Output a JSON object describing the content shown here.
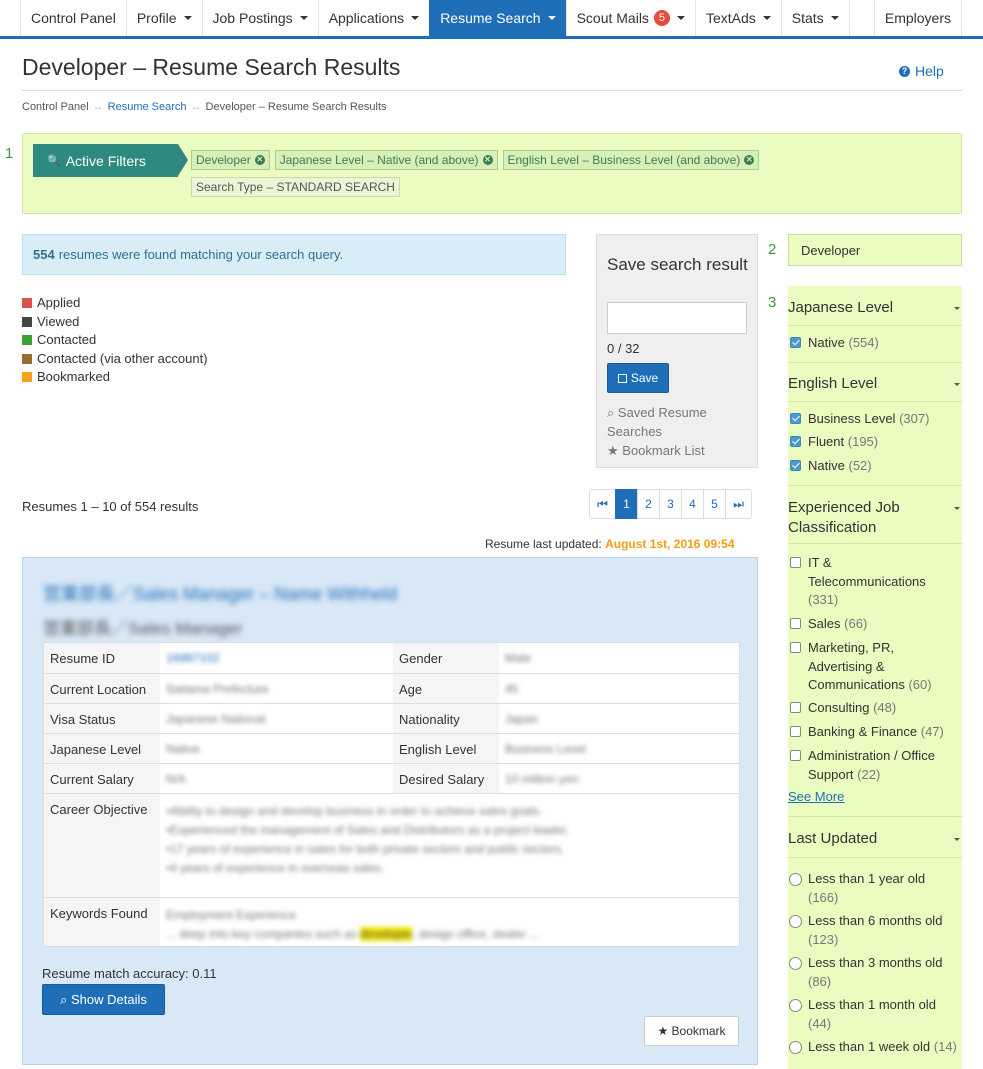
{
  "nav": {
    "items": [
      {
        "label": "Control Panel",
        "caret": false
      },
      {
        "label": "Profile",
        "caret": true
      },
      {
        "label": "Job Postings",
        "caret": true
      },
      {
        "label": "Applications",
        "caret": true
      },
      {
        "label": "Resume Search",
        "caret": true,
        "active": true
      },
      {
        "label": "Scout Mails",
        "caret": true,
        "badge": "5"
      },
      {
        "label": "TextAds",
        "caret": true
      },
      {
        "label": "Stats",
        "caret": true
      }
    ],
    "employers": "Employers"
  },
  "page": {
    "title": "Developer – Resume Search Results",
    "help": "Help",
    "breadcrumb": [
      "Control Panel",
      "Resume Search",
      "Developer – Resume Search Results"
    ]
  },
  "steps": [
    "1",
    "2",
    "3"
  ],
  "filters": {
    "label": "Active Filters",
    "chips": [
      {
        "text": "Developer",
        "removable": true
      },
      {
        "text": "Japanese Level – Native (and above)",
        "removable": true
      },
      {
        "text": "English Level – Business Level (and above)",
        "removable": true
      },
      {
        "text": "Search Type – STANDARD SEARCH",
        "removable": false
      }
    ]
  },
  "results": {
    "count": "554",
    "message": "resumes were found matching your search query.",
    "range": "Resumes 1 – 10 of 554 results",
    "updated_label": "Resume last updated:",
    "updated_value": "August 1st, 2016 09:54"
  },
  "legend": [
    {
      "label": "Applied",
      "color": "#d9534f"
    },
    {
      "label": "Viewed",
      "color": "#444444"
    },
    {
      "label": "Contacted",
      "color": "#3aa335"
    },
    {
      "label": "Contacted (via other account)",
      "color": "#9c6a35"
    },
    {
      "label": "Bookmarked",
      "color": "#f7a21b"
    }
  ],
  "save_search": {
    "title": "Save search result",
    "value": "",
    "count": "0 / 32",
    "button": "Save",
    "saved_link": "Saved Resume Searches",
    "bookmark_link": "Bookmark List"
  },
  "pagination": {
    "first": "⏮",
    "pages": [
      "1",
      "2",
      "3",
      "4",
      "5"
    ],
    "current": "1",
    "last": "⏭"
  },
  "resume": {
    "title": "営業部長／Sales Manager – Name Withheld",
    "subtitle": "営業部長／Sales Manager",
    "fields": {
      "resume_id_label": "Resume ID",
      "resume_id": "16987102",
      "gender_label": "Gender",
      "gender": "Male",
      "location_label": "Current Location",
      "location": "Saitama Prefecture",
      "age_label": "Age",
      "age": "45",
      "visa_label": "Visa Status",
      "visa": "Japanese National",
      "nationality_label": "Nationality",
      "nationality": "Japan",
      "jp_level_label": "Japanese Level",
      "jp_level": "Native",
      "en_level_label": "English Level",
      "en_level": "Business Level",
      "current_salary_label": "Current Salary",
      "current_salary": "N/A",
      "desired_salary_label": "Desired Salary",
      "desired_salary": "10 million yen",
      "objective_label": "Career Objective",
      "objective_lines": [
        "•Ability to design and develop business in order to achieve sales goals.",
        "•Experienced the management of Sales and Distributors as a project leader.",
        "•17 years of experience in sales for both private sectors and public sectors.",
        "•4 years of experience in overseas sales."
      ],
      "keywords_label": "Keywords Found",
      "keywords_heading": "Employment Experience",
      "keywords_pre": "... deep into key companies such as ",
      "keywords_hl": "developer",
      "keywords_post": ", design office, dealer ..."
    },
    "accuracy": "Resume match accuracy: 0.11",
    "show_details": "Show Details",
    "bookmark": "Bookmark"
  },
  "sidebar": {
    "keyword": "Developer",
    "japanese": {
      "title": "Japanese Level",
      "options": [
        {
          "label": "Native",
          "count": "(554)",
          "checked": true
        }
      ]
    },
    "english": {
      "title": "English Level",
      "options": [
        {
          "label": "Business Level",
          "count": "(307)",
          "checked": true
        },
        {
          "label": "Fluent",
          "count": "(195)",
          "checked": true
        },
        {
          "label": "Native",
          "count": "(52)",
          "checked": true
        }
      ]
    },
    "job_class": {
      "title": "Experienced Job Classification",
      "options": [
        {
          "label": "IT & Telecommunications",
          "count": "(331)"
        },
        {
          "label": "Sales",
          "count": "(66)"
        },
        {
          "label": "Marketing, PR, Advertising & Communications",
          "count": "(60)"
        },
        {
          "label": "Consulting",
          "count": "(48)"
        },
        {
          "label": "Banking & Finance",
          "count": "(47)"
        },
        {
          "label": "Administration / Office Support",
          "count": "(22)"
        }
      ],
      "see_more": "See More"
    },
    "last_updated": {
      "title": "Last Updated",
      "options": [
        {
          "label": "Less than 1 year old",
          "count": "(166)"
        },
        {
          "label": "Less than 6 months old",
          "count": "(123)"
        },
        {
          "label": "Less than 3 months old",
          "count": "(86)"
        },
        {
          "label": "Less than 1 month old",
          "count": "(44)"
        },
        {
          "label": "Less than 1 week old",
          "count": "(14)"
        }
      ]
    }
  }
}
